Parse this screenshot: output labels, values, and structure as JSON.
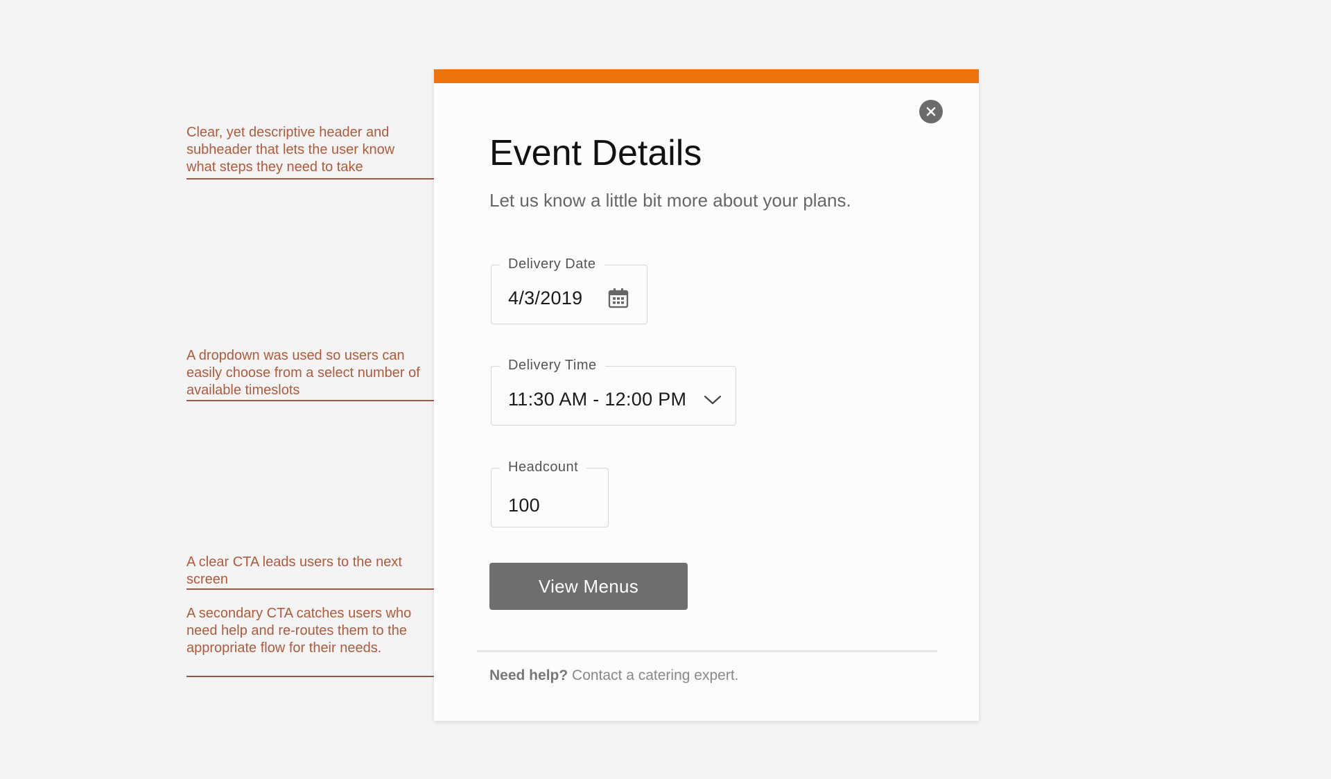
{
  "colors": {
    "accent": "#ee730c",
    "annotation": "#b05a3c",
    "cta_bg": "#6e6e6e"
  },
  "modal": {
    "close_icon": "close-icon",
    "title": "Event Details",
    "subtitle": "Let us know a little bit more about your plans.",
    "fields": {
      "delivery_date": {
        "label": "Delivery Date",
        "value": "4/3/2019",
        "icon": "calendar-icon"
      },
      "delivery_time": {
        "label": "Delivery Time",
        "value": "11:30 AM - 12:00 PM",
        "icon": "chevron-down-icon"
      },
      "headcount": {
        "label": "Headcount",
        "value": "100"
      }
    },
    "cta_label": "View Menus",
    "help_bold": "Need help?",
    "help_text": " Contact a catering expert."
  },
  "annotations": {
    "header": "Clear, yet descriptive header and subheader that lets the user know what steps they need to take",
    "dropdown": "A dropdown was used so users can easily choose from a select number of available timeslots",
    "cta": "A clear CTA leads users to the next screen",
    "secondary": "A secondary CTA catches users who need help and re-routes them to the appropriate flow for their needs."
  }
}
